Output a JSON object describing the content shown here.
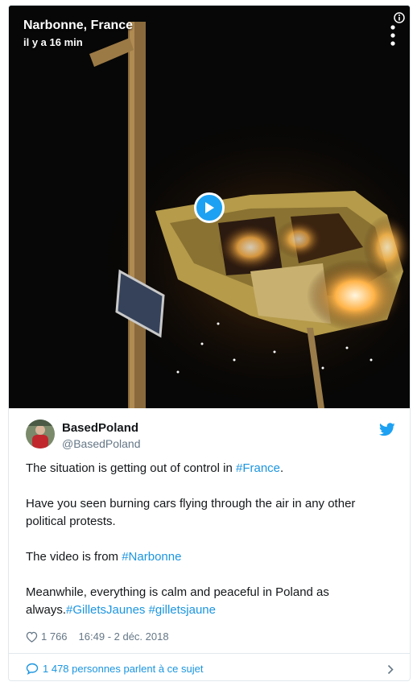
{
  "video": {
    "location": "Narbonne, France",
    "time_ago": "il y a 16 min",
    "icons": {
      "info": "info-icon",
      "more": "more-vertical-icon",
      "play": "play-icon"
    }
  },
  "tweet": {
    "author_name": "BasedPoland",
    "author_handle": "@BasedPoland",
    "bird_icon": "twitter-bird-icon",
    "bird_color": "#1da1f2",
    "paragraphs": {
      "p1_pre": "The situation is getting out of control in ",
      "p1_tag": "#France",
      "p1_post": ".",
      "p2": "Have you seen burning cars flying through the air in any other political protests.",
      "p3_pre": "The video is from ",
      "p3_tag": "#Narbonne",
      "p4_pre": "Meanwhile, everything is calm and peaceful in Poland as always.",
      "p4_tag1": "#GilletsJaunes",
      "p4_tag2": "#gilletsjaune"
    },
    "likes": "1 766",
    "timestamp": "16:49 - 2 déc. 2018",
    "conversation": "1 478 personnes parlent à ce sujet",
    "link_color": "#1b95e0"
  }
}
